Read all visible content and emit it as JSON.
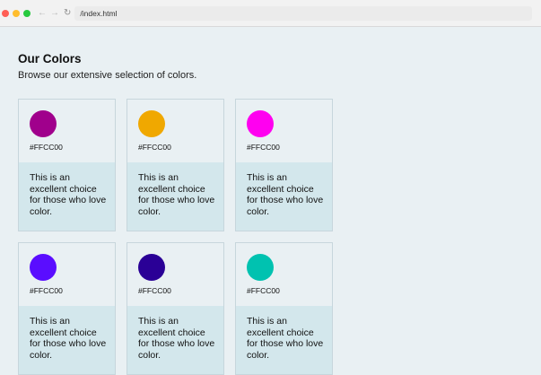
{
  "browser": {
    "traffic_lights": [
      "#ff5f56",
      "#ffbd2e",
      "#27c93f"
    ],
    "back_icon": "arrow-left",
    "forward_icon": "arrow-right",
    "reload_icon": "reload",
    "url": "/index.html"
  },
  "page": {
    "title": "Our Colors",
    "subtitle": "Browse our extensive selection of colors."
  },
  "cards": [
    {
      "color": "#a0008c",
      "hex": "#FFCC00",
      "description": "This is an excellent choice for those who love color."
    },
    {
      "color": "#f0a800",
      "hex": "#FFCC00",
      "description": "This is an excellent choice for those who love color."
    },
    {
      "color": "#ff00f0",
      "hex": "#FFCC00",
      "description": "This is an excellent choice for those who love color."
    },
    {
      "color": "#5a0dff",
      "hex": "#FFCC00",
      "description": "This is an excellent choice for those who love color."
    },
    {
      "color": "#2a0096",
      "hex": "#FFCC00",
      "description": "This is an excellent choice for those who love color."
    },
    {
      "color": "#00c2b0",
      "hex": "#FFCC00",
      "description": "This is an excellent choice for those who love color."
    }
  ]
}
